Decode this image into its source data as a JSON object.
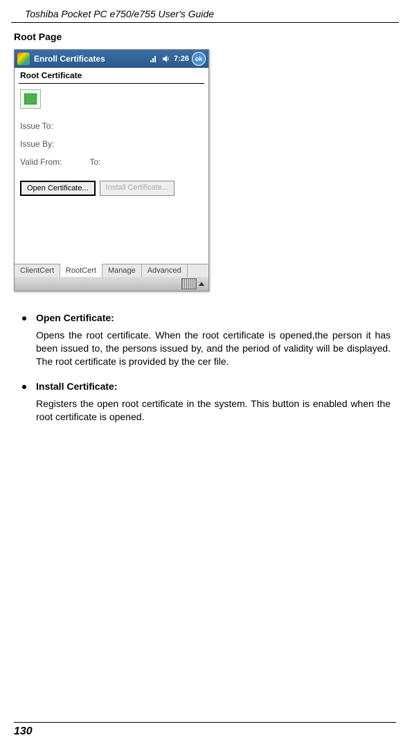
{
  "header": "Toshiba Pocket PC e750/e755  User's Guide",
  "section_title": "Root Page",
  "screenshot": {
    "titlebar": {
      "title": "Enroll Certificates",
      "time": "7:26"
    },
    "page_title": "Root Certificate",
    "fields": {
      "issue_to_label": "Issue To:",
      "issue_by_label": "Issue By:",
      "valid_from_label": "Valid From:",
      "to_label": "To:"
    },
    "buttons": {
      "open_cert": "Open Certificate...",
      "install_cert": "Install Certificate..."
    },
    "tabs": [
      "ClientCert",
      "RootCert",
      "Manage",
      "Advanced"
    ]
  },
  "bullets": [
    {
      "title": "Open Certificate:",
      "desc": "Opens the root certificate.  When the root certificate is opened,the person it has been issued to, the persons issued by, and the period of validity will be displayed. The root certificate is provided by the cer file."
    },
    {
      "title": "Install Certificate:",
      "desc": "Registers the open root certificate in the system. This button is enabled when the root certificate is opened."
    }
  ],
  "page_number": "130"
}
